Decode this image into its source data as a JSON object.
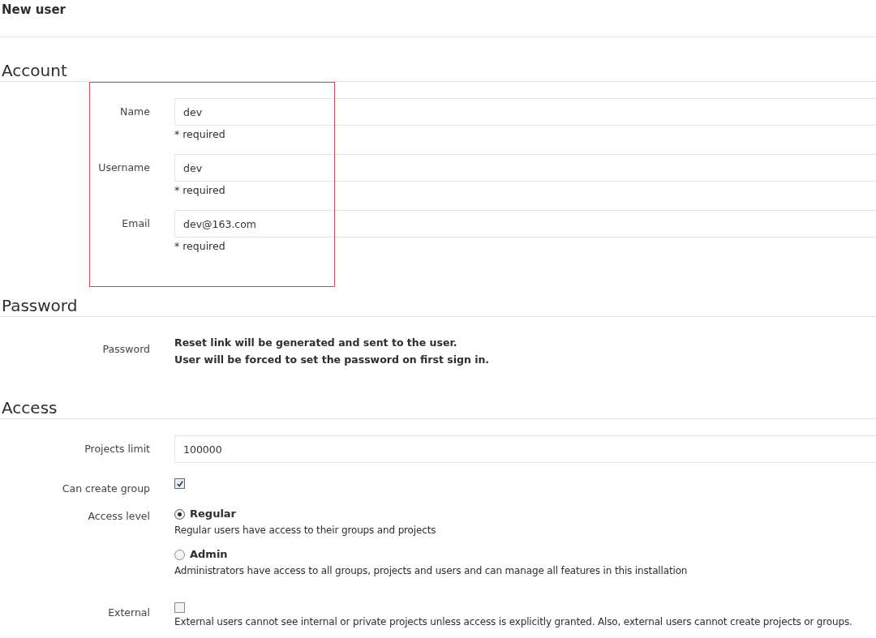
{
  "page_title": "New user",
  "sections": [
    {
      "title": "Account",
      "highlighted": true,
      "rows": [
        {
          "kind": "text_input",
          "label": "Name",
          "value": "dev",
          "hint": "* required"
        },
        {
          "kind": "text_input",
          "label": "Username",
          "value": "dev",
          "hint": "* required"
        },
        {
          "kind": "text_input",
          "label": "Email",
          "value": "dev@163.com",
          "hint": "* required"
        }
      ]
    },
    {
      "title": "Password",
      "highlighted": false,
      "rows": [
        {
          "kind": "note",
          "label": "Password",
          "lines": [
            "Reset link will be generated and sent to the user.",
            "User will be forced to set the password on first sign in."
          ]
        }
      ]
    },
    {
      "title": "Access",
      "highlighted": false,
      "rows": [
        {
          "kind": "text_input",
          "label": "Projects limit",
          "value": "100000"
        },
        {
          "kind": "checkbox",
          "label": "Can create group",
          "checked": true
        },
        {
          "kind": "radio_group",
          "label": "Access level",
          "options": [
            {
              "label": "Regular",
              "selected": true,
              "help": "Regular users have access to their groups and projects"
            },
            {
              "label": "Admin",
              "selected": false,
              "help": "Administrators have access to all groups, projects and users and can manage all features in this installation"
            }
          ]
        },
        {
          "kind": "checkbox",
          "label": "External",
          "checked": false,
          "help": "External users cannot see internal or private projects unless access is explicitly granted. Also, external users cannot create projects or groups."
        }
      ]
    }
  ]
}
